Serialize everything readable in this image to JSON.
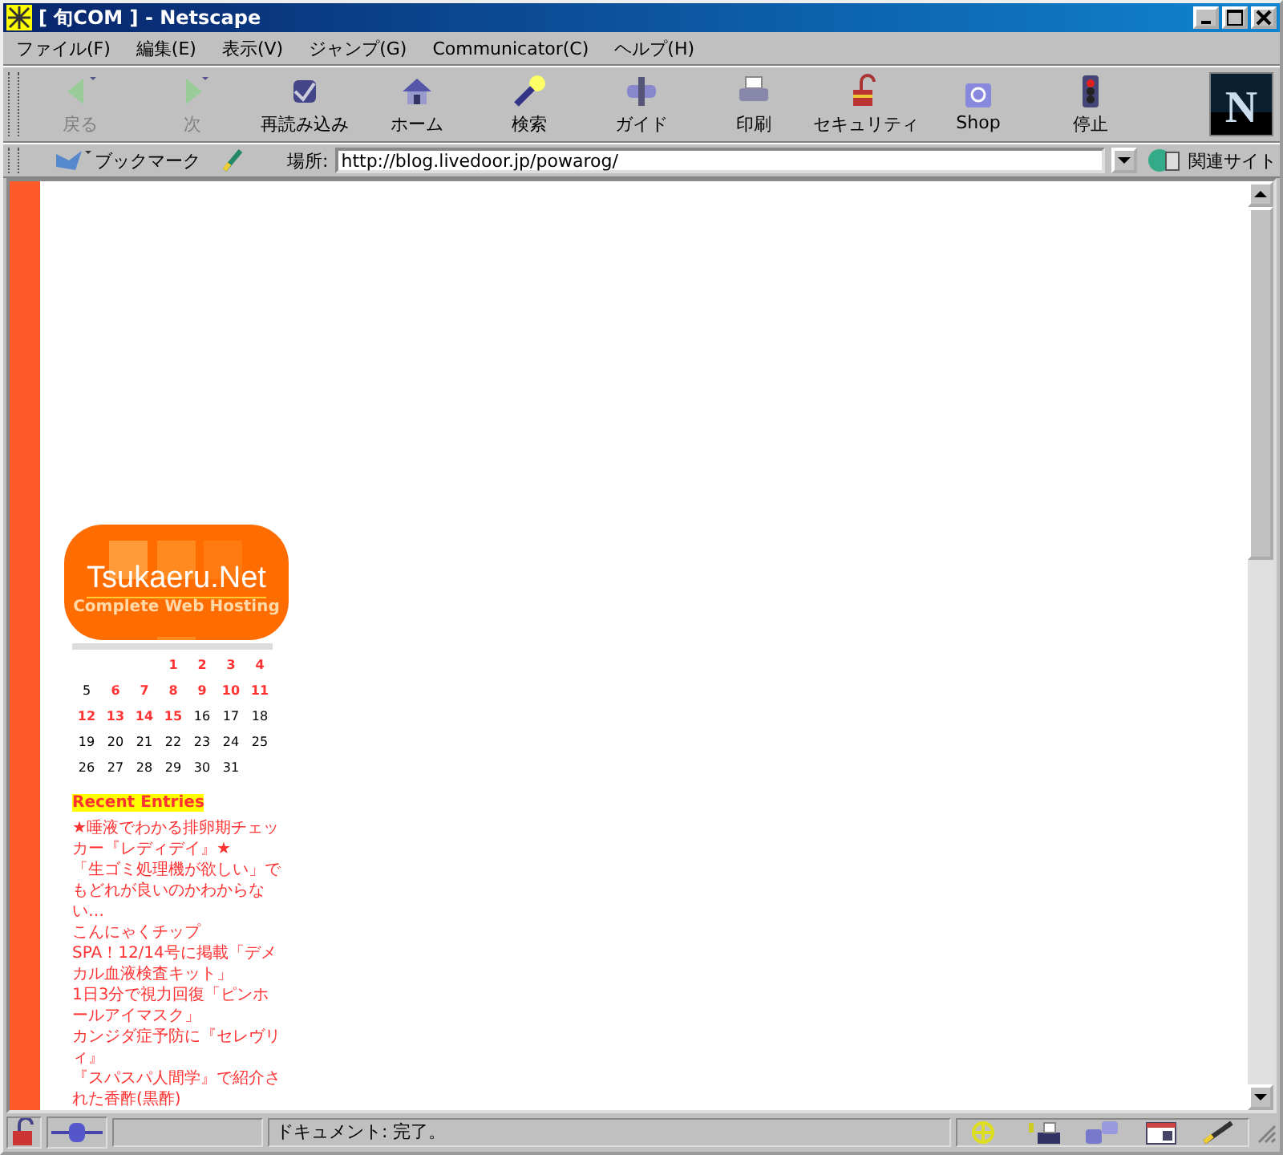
{
  "window": {
    "title": "[ 旬COM ] - Netscape"
  },
  "menu": [
    "ファイル(F)",
    "編集(E)",
    "表示(V)",
    "ジャンプ(G)",
    "Communicator(C)",
    "ヘルプ(H)"
  ],
  "toolbar": [
    {
      "kind": "back",
      "label": "戻る",
      "disabled": true
    },
    {
      "kind": "forward",
      "label": "次",
      "disabled": true
    },
    {
      "kind": "reload",
      "label": "再読み込み",
      "disabled": false
    },
    {
      "kind": "home",
      "label": "ホーム",
      "disabled": false
    },
    {
      "kind": "search",
      "label": "検索",
      "disabled": false
    },
    {
      "kind": "guide",
      "label": "ガイド",
      "disabled": false
    },
    {
      "kind": "print",
      "label": "印刷",
      "disabled": false
    },
    {
      "kind": "security",
      "label": "セキュリティ",
      "disabled": false
    },
    {
      "kind": "shop",
      "label": "Shop",
      "disabled": false
    },
    {
      "kind": "stop",
      "label": "停止",
      "disabled": false
    }
  ],
  "brand_mark": "N",
  "location_bar": {
    "bookmarks": "ブックマーク",
    "label": "場所:",
    "url": "http://blog.livedoor.jp/powarog/",
    "related": "関連サイト"
  },
  "logo": {
    "title": "Tsukaeru.Net",
    "subtitle": "Complete Web Hosting"
  },
  "calendar": {
    "weeks": [
      {
        "days": [
          {
            "day": "1",
            "linked": true
          },
          {
            "day": "2",
            "linked": true
          },
          {
            "day": "3",
            "linked": true
          },
          {
            "day": "4",
            "linked": true
          }
        ]
      },
      {
        "days": [
          {
            "day": "5",
            "linked": false
          },
          {
            "day": "6",
            "linked": true
          },
          {
            "day": "7",
            "linked": true
          },
          {
            "day": "8",
            "linked": true
          },
          {
            "day": "9",
            "linked": true
          },
          {
            "day": "10",
            "linked": true
          },
          {
            "day": "11",
            "linked": true
          }
        ]
      },
      {
        "days": [
          {
            "day": "12",
            "linked": true
          },
          {
            "day": "13",
            "linked": true
          },
          {
            "day": "14",
            "linked": true
          },
          {
            "day": "15",
            "linked": true
          },
          {
            "day": "16",
            "linked": false
          },
          {
            "day": "17",
            "linked": false
          },
          {
            "day": "18",
            "linked": false
          }
        ]
      },
      {
        "days": [
          {
            "day": "19",
            "linked": false
          },
          {
            "day": "20",
            "linked": false
          },
          {
            "day": "21",
            "linked": false
          },
          {
            "day": "22",
            "linked": false
          },
          {
            "day": "23",
            "linked": false
          },
          {
            "day": "24",
            "linked": false
          },
          {
            "day": "25",
            "linked": false
          }
        ]
      },
      {
        "days": [
          {
            "day": "26",
            "linked": false
          },
          {
            "day": "27",
            "linked": false
          },
          {
            "day": "28",
            "linked": false
          },
          {
            "day": "29",
            "linked": false
          },
          {
            "day": "30",
            "linked": false
          },
          {
            "day": "31",
            "linked": false
          }
        ]
      }
    ]
  },
  "recent_entries": {
    "heading": "Recent Entries",
    "entries": [
      "★唾液でわかる排卵期チェッカー『レディデイ』★",
      "「生ゴミ処理機が欲しい」でもどれが良いのかわからない…",
      "こんにゃくチップ",
      "SPA！12/14号に掲載「デメカル血液検査キット」",
      "1日3分で視力回復「ピンホールアイマスク」",
      "カンジダ症予防に『セレヴリィ』",
      "『スパスパ人間学』で紹介された香酢(黒酢)"
    ]
  },
  "status_bar": {
    "text": "ドキュメント: 完了。"
  }
}
